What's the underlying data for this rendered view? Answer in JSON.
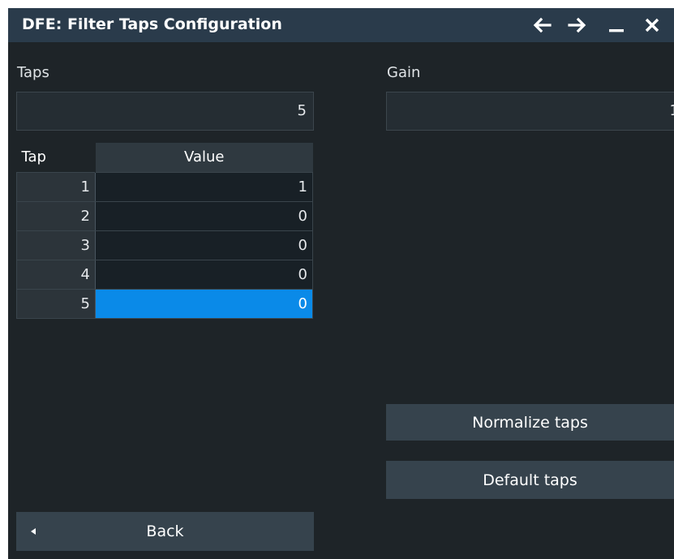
{
  "titlebar": {
    "title": "DFE: Filter Taps Configuration",
    "icons": [
      "arrow-left-icon",
      "arrow-right-icon",
      "minimize-icon",
      "close-icon"
    ]
  },
  "taps_field": {
    "label": "Taps",
    "value": "5"
  },
  "gain_field": {
    "label": "Gain",
    "value": "1"
  },
  "table": {
    "headers": {
      "tap": "Tap",
      "value": "Value"
    },
    "rows": [
      {
        "tap": "1",
        "value": "1"
      },
      {
        "tap": "2",
        "value": "0"
      },
      {
        "tap": "3",
        "value": "0"
      },
      {
        "tap": "4",
        "value": "0"
      },
      {
        "tap": "5",
        "value": "0"
      }
    ],
    "selected_row": 4
  },
  "buttons": {
    "normalize": "Normalize taps",
    "default": "Default taps",
    "back": "Back"
  },
  "colors": {
    "accent": "#0a8ae8",
    "titlebar": "#2a3b4b",
    "background": "#1e2428"
  }
}
